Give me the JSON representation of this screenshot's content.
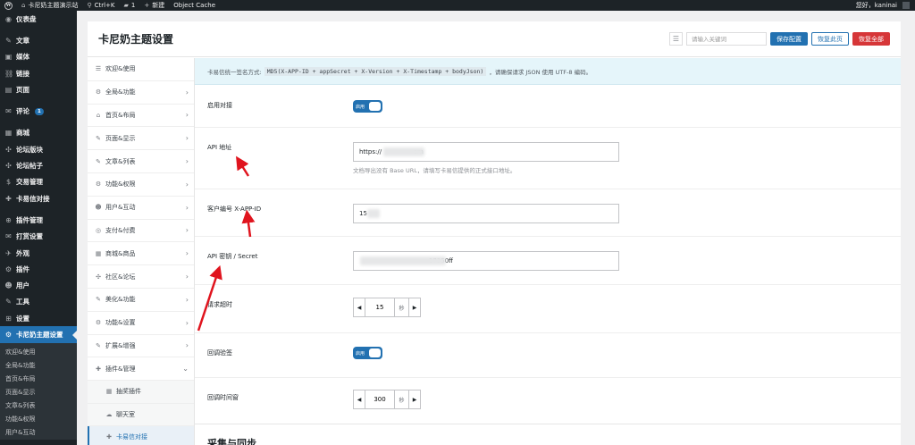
{
  "adminbar": {
    "site_name": "卡尼奶主题演示站",
    "shortcut": "Ctrl+K",
    "comments": "1",
    "new_label": "新建",
    "object_cache": "Object Cache",
    "greeting": "您好，kaninai"
  },
  "menu": {
    "items": [
      {
        "icon": "◉",
        "label": "仪表盘"
      },
      {
        "icon": "✎",
        "label": "文章"
      },
      {
        "icon": "▣",
        "label": "媒体"
      },
      {
        "icon": "⛓",
        "label": "链接"
      },
      {
        "icon": "▤",
        "label": "页面"
      },
      {
        "icon": "✉",
        "label": "评论",
        "badge": "1"
      },
      {
        "icon": "▦",
        "label": "商城"
      },
      {
        "icon": "✣",
        "label": "论坛版块"
      },
      {
        "icon": "✣",
        "label": "论坛帖子"
      },
      {
        "icon": "$",
        "label": "交易管理"
      },
      {
        "icon": "✚",
        "label": "卡易信对接"
      },
      {
        "icon": "⊕",
        "label": "插件管理"
      },
      {
        "icon": "✉",
        "label": "打赏设置"
      },
      {
        "icon": "✈",
        "label": "外观"
      },
      {
        "icon": "⚙",
        "label": "插件"
      },
      {
        "icon": "☻",
        "label": "用户"
      },
      {
        "icon": "✎",
        "label": "工具"
      },
      {
        "icon": "⊞",
        "label": "设置"
      },
      {
        "icon": "⚙",
        "label": "卡尼奶主题设置"
      }
    ],
    "sub_items": [
      "欢迎&使用",
      "全局&功能",
      "首页&布局",
      "页面&显示",
      "文章&列表",
      "功能&权限",
      "用户&互动"
    ]
  },
  "panel": {
    "title": "卡尼奶主题设置",
    "search_placeholder": "请输入关键词",
    "save_label": "保存配置",
    "restore_page_label": "恢复此页",
    "restore_all_label": "恢复全部"
  },
  "tabs": [
    {
      "icon": "☰",
      "label": "欢迎&使用",
      "chevron": ""
    },
    {
      "icon": "⚙",
      "label": "全局&功能",
      "chevron": "›"
    },
    {
      "icon": "⌂",
      "label": "首页&布局",
      "chevron": "›"
    },
    {
      "icon": "✎",
      "label": "页面&显示",
      "chevron": "›"
    },
    {
      "icon": "✎",
      "label": "文章&列表",
      "chevron": "›"
    },
    {
      "icon": "⚙",
      "label": "功能&权限",
      "chevron": "›"
    },
    {
      "icon": "☻",
      "label": "用户&互动",
      "chevron": "›"
    },
    {
      "icon": "◎",
      "label": "支付&付费",
      "chevron": "›"
    },
    {
      "icon": "▦",
      "label": "商城&商品",
      "chevron": "›"
    },
    {
      "icon": "✣",
      "label": "社区&论坛",
      "chevron": "›"
    },
    {
      "icon": "✎",
      "label": "美化&功能",
      "chevron": "›"
    },
    {
      "icon": "⚙",
      "label": "功能&设置",
      "chevron": "›"
    },
    {
      "icon": "✎",
      "label": "扩展&增强",
      "chevron": "›"
    },
    {
      "icon": "✚",
      "label": "插件&管理",
      "chevron": "⌄"
    }
  ],
  "sub_tabs": [
    {
      "icon": "▦",
      "label": "抽奖插件"
    },
    {
      "icon": "☁",
      "label": "聊天室"
    },
    {
      "icon": "✚",
      "label": "卡易信对接"
    }
  ],
  "notice": {
    "prefix": "卡易信统一签名方式:",
    "formula": "MD5(X-APP-ID + appSecret + X-Version + X-Timestamp + bodyJson)",
    "suffix": "，请确保请求 JSON 使用 UTF-8 编码。"
  },
  "fields": {
    "enable": {
      "label": "启用对接",
      "toggle_text": "启用"
    },
    "api_url": {
      "label": "API 地址",
      "value": "https://                om",
      "help": "文档导出没有 Base URL，请填写卡易信提供的正式接口地址。"
    },
    "client_id": {
      "label": "客户编号 X-APP-ID",
      "value": "15"
    },
    "secret": {
      "label": "API 密钥 / Secret",
      "value": "                                   17350ff"
    },
    "timeout": {
      "label": "请求超时",
      "value": "15",
      "unit": "秒"
    },
    "callback_verify": {
      "label": "回调验签",
      "toggle_text": "启用"
    },
    "callback_window": {
      "label": "回调时间窗",
      "value": "300",
      "unit": "秒"
    }
  },
  "section": {
    "title": "采集与同步"
  },
  "colors": {
    "accent": "#2271b1",
    "danger": "#d63638",
    "annotation": "#e0141e"
  }
}
